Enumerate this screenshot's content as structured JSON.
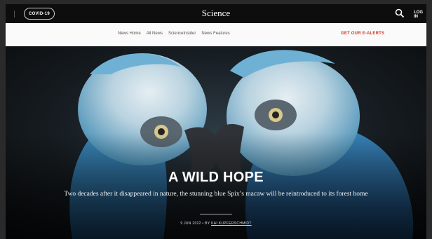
{
  "topbar": {
    "covid_label": "COVID-19",
    "brand": "Science",
    "login_label": "LOG IN",
    "search_icon": "search-icon"
  },
  "nav": {
    "links": [
      "News Home",
      "All News",
      "ScienceInsider",
      "News Features"
    ],
    "alerts_label": "GET OUR E-ALERTS"
  },
  "hero": {
    "headline": "A WILD HOPE",
    "subhead": "Two decades after it disappeared in nature, the stunning blue Spix’s macaw will be reintroduced to its forest home",
    "date": "9 JUN 2022",
    "by": "BY",
    "author": "KAI KUPFERSCHMIDT"
  },
  "colors": {
    "accent": "#cc3a2a",
    "topbar": "#0d0d0d",
    "nav_bg": "#fafafa"
  }
}
